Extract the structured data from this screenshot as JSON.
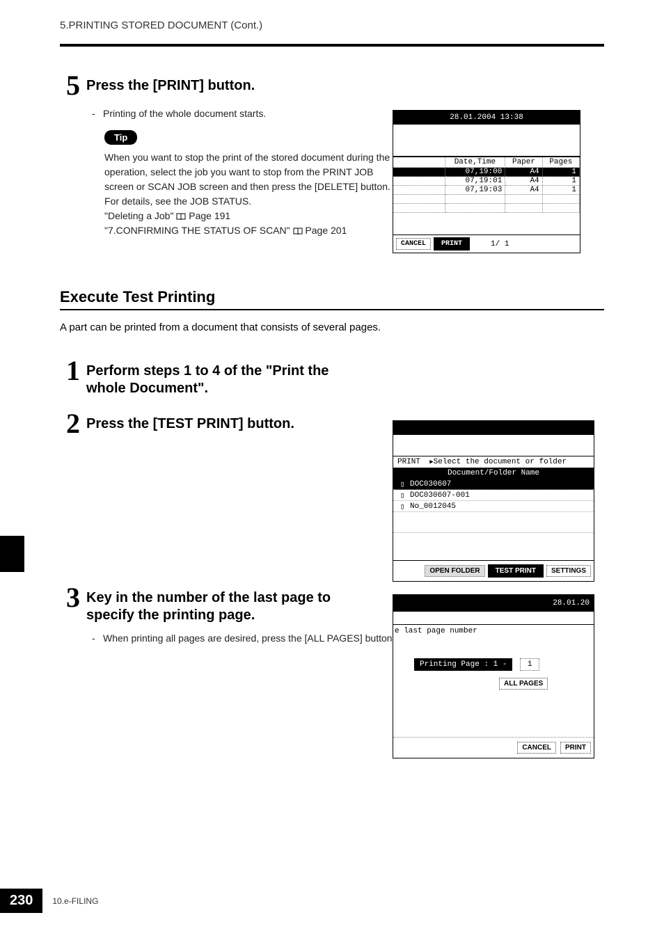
{
  "header": {
    "title": "5.PRINTING STORED DOCUMENT (Cont.)"
  },
  "step5": {
    "num": "5",
    "title": "Press the [PRINT] button.",
    "bullet": "Printing of the whole document starts.",
    "tip_label": "Tip",
    "tip_para1": "When you want to stop the print of the stored document during the operation, select the job you want to stop from the PRINT JOB screen or SCAN JOB screen and then press the [DELETE] button. For details, see the JOB STATUS.",
    "tip_ref1": "\"Deleting a Job\"",
    "tip_ref1_page": "Page 191",
    "tip_ref2": "\"7.CONFIRMING THE STATUS OF SCAN\"",
    "tip_ref2_page": "Page 201"
  },
  "panel_top": {
    "datetime": "28.01.2004 13:38",
    "cols": {
      "dt": "Date,Time",
      "paper": "Paper",
      "pages": "Pages"
    },
    "rows": [
      {
        "dt": "07,19:00",
        "paper": "A4",
        "pages": "1",
        "hl": true
      },
      {
        "dt": "07,19:01",
        "paper": "A4",
        "pages": "1",
        "hl": false
      },
      {
        "dt": "07,19:03",
        "paper": "A4",
        "pages": "1",
        "hl": false
      }
    ],
    "cancel": "CANCEL",
    "print": "PRINT",
    "page_ind": "1/  1"
  },
  "section": {
    "title": "Execute Test Printing",
    "intro": "A part can be printed from a document that consists of several pages."
  },
  "step1": {
    "num": "1",
    "title_a": "Perform steps 1 to 4 of the \"Print the",
    "title_b": "whole Document\"."
  },
  "step2": {
    "num": "2",
    "title": "Press the [TEST PRINT] button."
  },
  "panel_mid": {
    "prompt_prefix": "PRINT",
    "prompt": "Select the document or folder",
    "col": "Document/Folder Name",
    "rows": [
      {
        "name": "DOC030607",
        "hl": true
      },
      {
        "name": "DOC030607-001",
        "hl": false
      },
      {
        "name": "No_0012045",
        "hl": false
      }
    ],
    "open": "OPEN FOLDER",
    "test": "TEST PRINT",
    "settings": "SETTINGS"
  },
  "step3": {
    "num": "3",
    "title_a": "Key in the number of the last page to",
    "title_b": "specify the printing page.",
    "bullet": "When printing all pages are desired, press the [ALL PAGES] button."
  },
  "panel_low": {
    "date": "28.01.20",
    "hint": "e last page number",
    "pp_label": "Printing Page   : 1 -",
    "pp_value": "1",
    "all_pages": "ALL PAGES",
    "cancel": "CANCEL",
    "print": "PRINT"
  },
  "footer": {
    "page": "230",
    "chapter": "10.e-FILING"
  }
}
